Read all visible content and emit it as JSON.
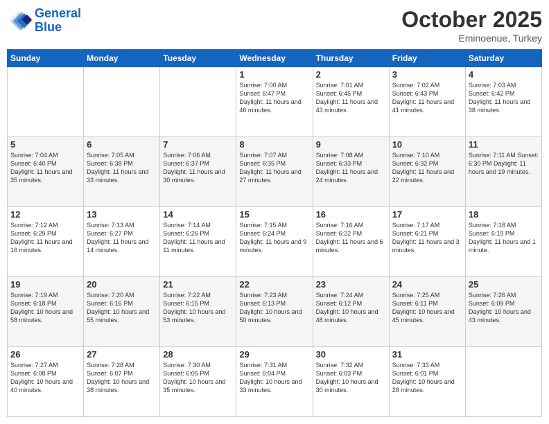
{
  "logo": {
    "line1": "General",
    "line2": "Blue"
  },
  "title": "October 2025",
  "subtitle": "Eminoenue, Turkey",
  "headers": [
    "Sunday",
    "Monday",
    "Tuesday",
    "Wednesday",
    "Thursday",
    "Friday",
    "Saturday"
  ],
  "weeks": [
    [
      {
        "day": "",
        "text": ""
      },
      {
        "day": "",
        "text": ""
      },
      {
        "day": "",
        "text": ""
      },
      {
        "day": "1",
        "text": "Sunrise: 7:00 AM\nSunset: 6:47 PM\nDaylight: 11 hours\nand 46 minutes."
      },
      {
        "day": "2",
        "text": "Sunrise: 7:01 AM\nSunset: 6:45 PM\nDaylight: 11 hours\nand 43 minutes."
      },
      {
        "day": "3",
        "text": "Sunrise: 7:02 AM\nSunset: 6:43 PM\nDaylight: 11 hours\nand 41 minutes."
      },
      {
        "day": "4",
        "text": "Sunrise: 7:03 AM\nSunset: 6:42 PM\nDaylight: 11 hours\nand 38 minutes."
      }
    ],
    [
      {
        "day": "5",
        "text": "Sunrise: 7:04 AM\nSunset: 6:40 PM\nDaylight: 11 hours\nand 35 minutes."
      },
      {
        "day": "6",
        "text": "Sunrise: 7:05 AM\nSunset: 6:38 PM\nDaylight: 11 hours\nand 33 minutes."
      },
      {
        "day": "7",
        "text": "Sunrise: 7:06 AM\nSunset: 6:37 PM\nDaylight: 11 hours\nand 30 minutes."
      },
      {
        "day": "8",
        "text": "Sunrise: 7:07 AM\nSunset: 6:35 PM\nDaylight: 11 hours\nand 27 minutes."
      },
      {
        "day": "9",
        "text": "Sunrise: 7:08 AM\nSunset: 6:33 PM\nDaylight: 11 hours\nand 24 minutes."
      },
      {
        "day": "10",
        "text": "Sunrise: 7:10 AM\nSunset: 6:32 PM\nDaylight: 11 hours\nand 22 minutes."
      },
      {
        "day": "11",
        "text": "Sunrise: 7:11 AM\nSunset: 6:30 PM\nDaylight: 11 hours\nand 19 minutes."
      }
    ],
    [
      {
        "day": "12",
        "text": "Sunrise: 7:12 AM\nSunset: 6:29 PM\nDaylight: 11 hours\nand 16 minutes."
      },
      {
        "day": "13",
        "text": "Sunrise: 7:13 AM\nSunset: 6:27 PM\nDaylight: 11 hours\nand 14 minutes."
      },
      {
        "day": "14",
        "text": "Sunrise: 7:14 AM\nSunset: 6:26 PM\nDaylight: 11 hours\nand 11 minutes."
      },
      {
        "day": "15",
        "text": "Sunrise: 7:15 AM\nSunset: 6:24 PM\nDaylight: 11 hours\nand 9 minutes."
      },
      {
        "day": "16",
        "text": "Sunrise: 7:16 AM\nSunset: 6:22 PM\nDaylight: 11 hours\nand 6 minutes."
      },
      {
        "day": "17",
        "text": "Sunrise: 7:17 AM\nSunset: 6:21 PM\nDaylight: 11 hours\nand 3 minutes."
      },
      {
        "day": "18",
        "text": "Sunrise: 7:18 AM\nSunset: 6:19 PM\nDaylight: 11 hours\nand 1 minute."
      }
    ],
    [
      {
        "day": "19",
        "text": "Sunrise: 7:19 AM\nSunset: 6:18 PM\nDaylight: 10 hours\nand 58 minutes."
      },
      {
        "day": "20",
        "text": "Sunrise: 7:20 AM\nSunset: 6:16 PM\nDaylight: 10 hours\nand 55 minutes."
      },
      {
        "day": "21",
        "text": "Sunrise: 7:22 AM\nSunset: 6:15 PM\nDaylight: 10 hours\nand 53 minutes."
      },
      {
        "day": "22",
        "text": "Sunrise: 7:23 AM\nSunset: 6:13 PM\nDaylight: 10 hours\nand 50 minutes."
      },
      {
        "day": "23",
        "text": "Sunrise: 7:24 AM\nSunset: 6:12 PM\nDaylight: 10 hours\nand 48 minutes."
      },
      {
        "day": "24",
        "text": "Sunrise: 7:25 AM\nSunset: 6:11 PM\nDaylight: 10 hours\nand 45 minutes."
      },
      {
        "day": "25",
        "text": "Sunrise: 7:26 AM\nSunset: 6:09 PM\nDaylight: 10 hours\nand 43 minutes."
      }
    ],
    [
      {
        "day": "26",
        "text": "Sunrise: 7:27 AM\nSunset: 6:08 PM\nDaylight: 10 hours\nand 40 minutes."
      },
      {
        "day": "27",
        "text": "Sunrise: 7:28 AM\nSunset: 6:07 PM\nDaylight: 10 hours\nand 38 minutes."
      },
      {
        "day": "28",
        "text": "Sunrise: 7:30 AM\nSunset: 6:05 PM\nDaylight: 10 hours\nand 35 minutes."
      },
      {
        "day": "29",
        "text": "Sunrise: 7:31 AM\nSunset: 6:04 PM\nDaylight: 10 hours\nand 33 minutes."
      },
      {
        "day": "30",
        "text": "Sunrise: 7:32 AM\nSunset: 6:03 PM\nDaylight: 10 hours\nand 30 minutes."
      },
      {
        "day": "31",
        "text": "Sunrise: 7:33 AM\nSunset: 6:01 PM\nDaylight: 10 hours\nand 28 minutes."
      },
      {
        "day": "",
        "text": ""
      }
    ]
  ]
}
